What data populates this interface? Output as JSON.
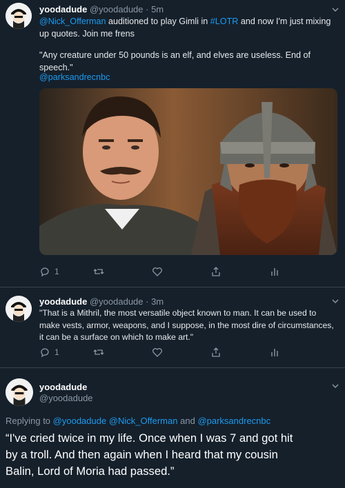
{
  "tweets": [
    {
      "name": "yoodadude",
      "handle": "@yoodadude",
      "time": "5m",
      "mention": "@Nick_Offerman",
      "text_a": "auditioned to play Gimli in",
      "hashtag": "#LOTR",
      "text_b": "and now I'm just mixing",
      "text_c": "up quotes. Join me frens",
      "quote": "\"Any creature under 50 pounds is an elf, and elves are useless. End of speech.\"",
      "tag": "@parksandrecnbc",
      "reply_count": "1"
    },
    {
      "name": "yoodadude",
      "handle": "@yoodadude",
      "time": "3m",
      "line1": "\"That is a Mithril, the most versatile object known to man. It can be used to",
      "line2": "make vests, armor, weapons, and I suppose, in the most dire of circumstances,",
      "line3": "it can be a surface on which to make art.\"",
      "reply_count": "1"
    },
    {
      "name": "yoodadude",
      "handle": "@yoodadude",
      "replying_label": "Replying to",
      "replying_to": "@yoodadude @Nick_Offerman",
      "and": "and",
      "replying_to_2": "@parksandrecnbc",
      "line1": "“I've cried twice in my life. Once when I was 7 and got hit",
      "line2": "by a troll. And then again when I heard that my cousin",
      "line3": "Balin, Lord of Moria had passed.”"
    }
  ],
  "colors": {
    "background": "#15202b",
    "link": "#1d9bf0",
    "muted": "#8b98a5"
  },
  "icons": [
    "reply-icon",
    "retweet-icon",
    "like-icon",
    "share-icon",
    "analytics-icon",
    "chevron-down-icon"
  ]
}
